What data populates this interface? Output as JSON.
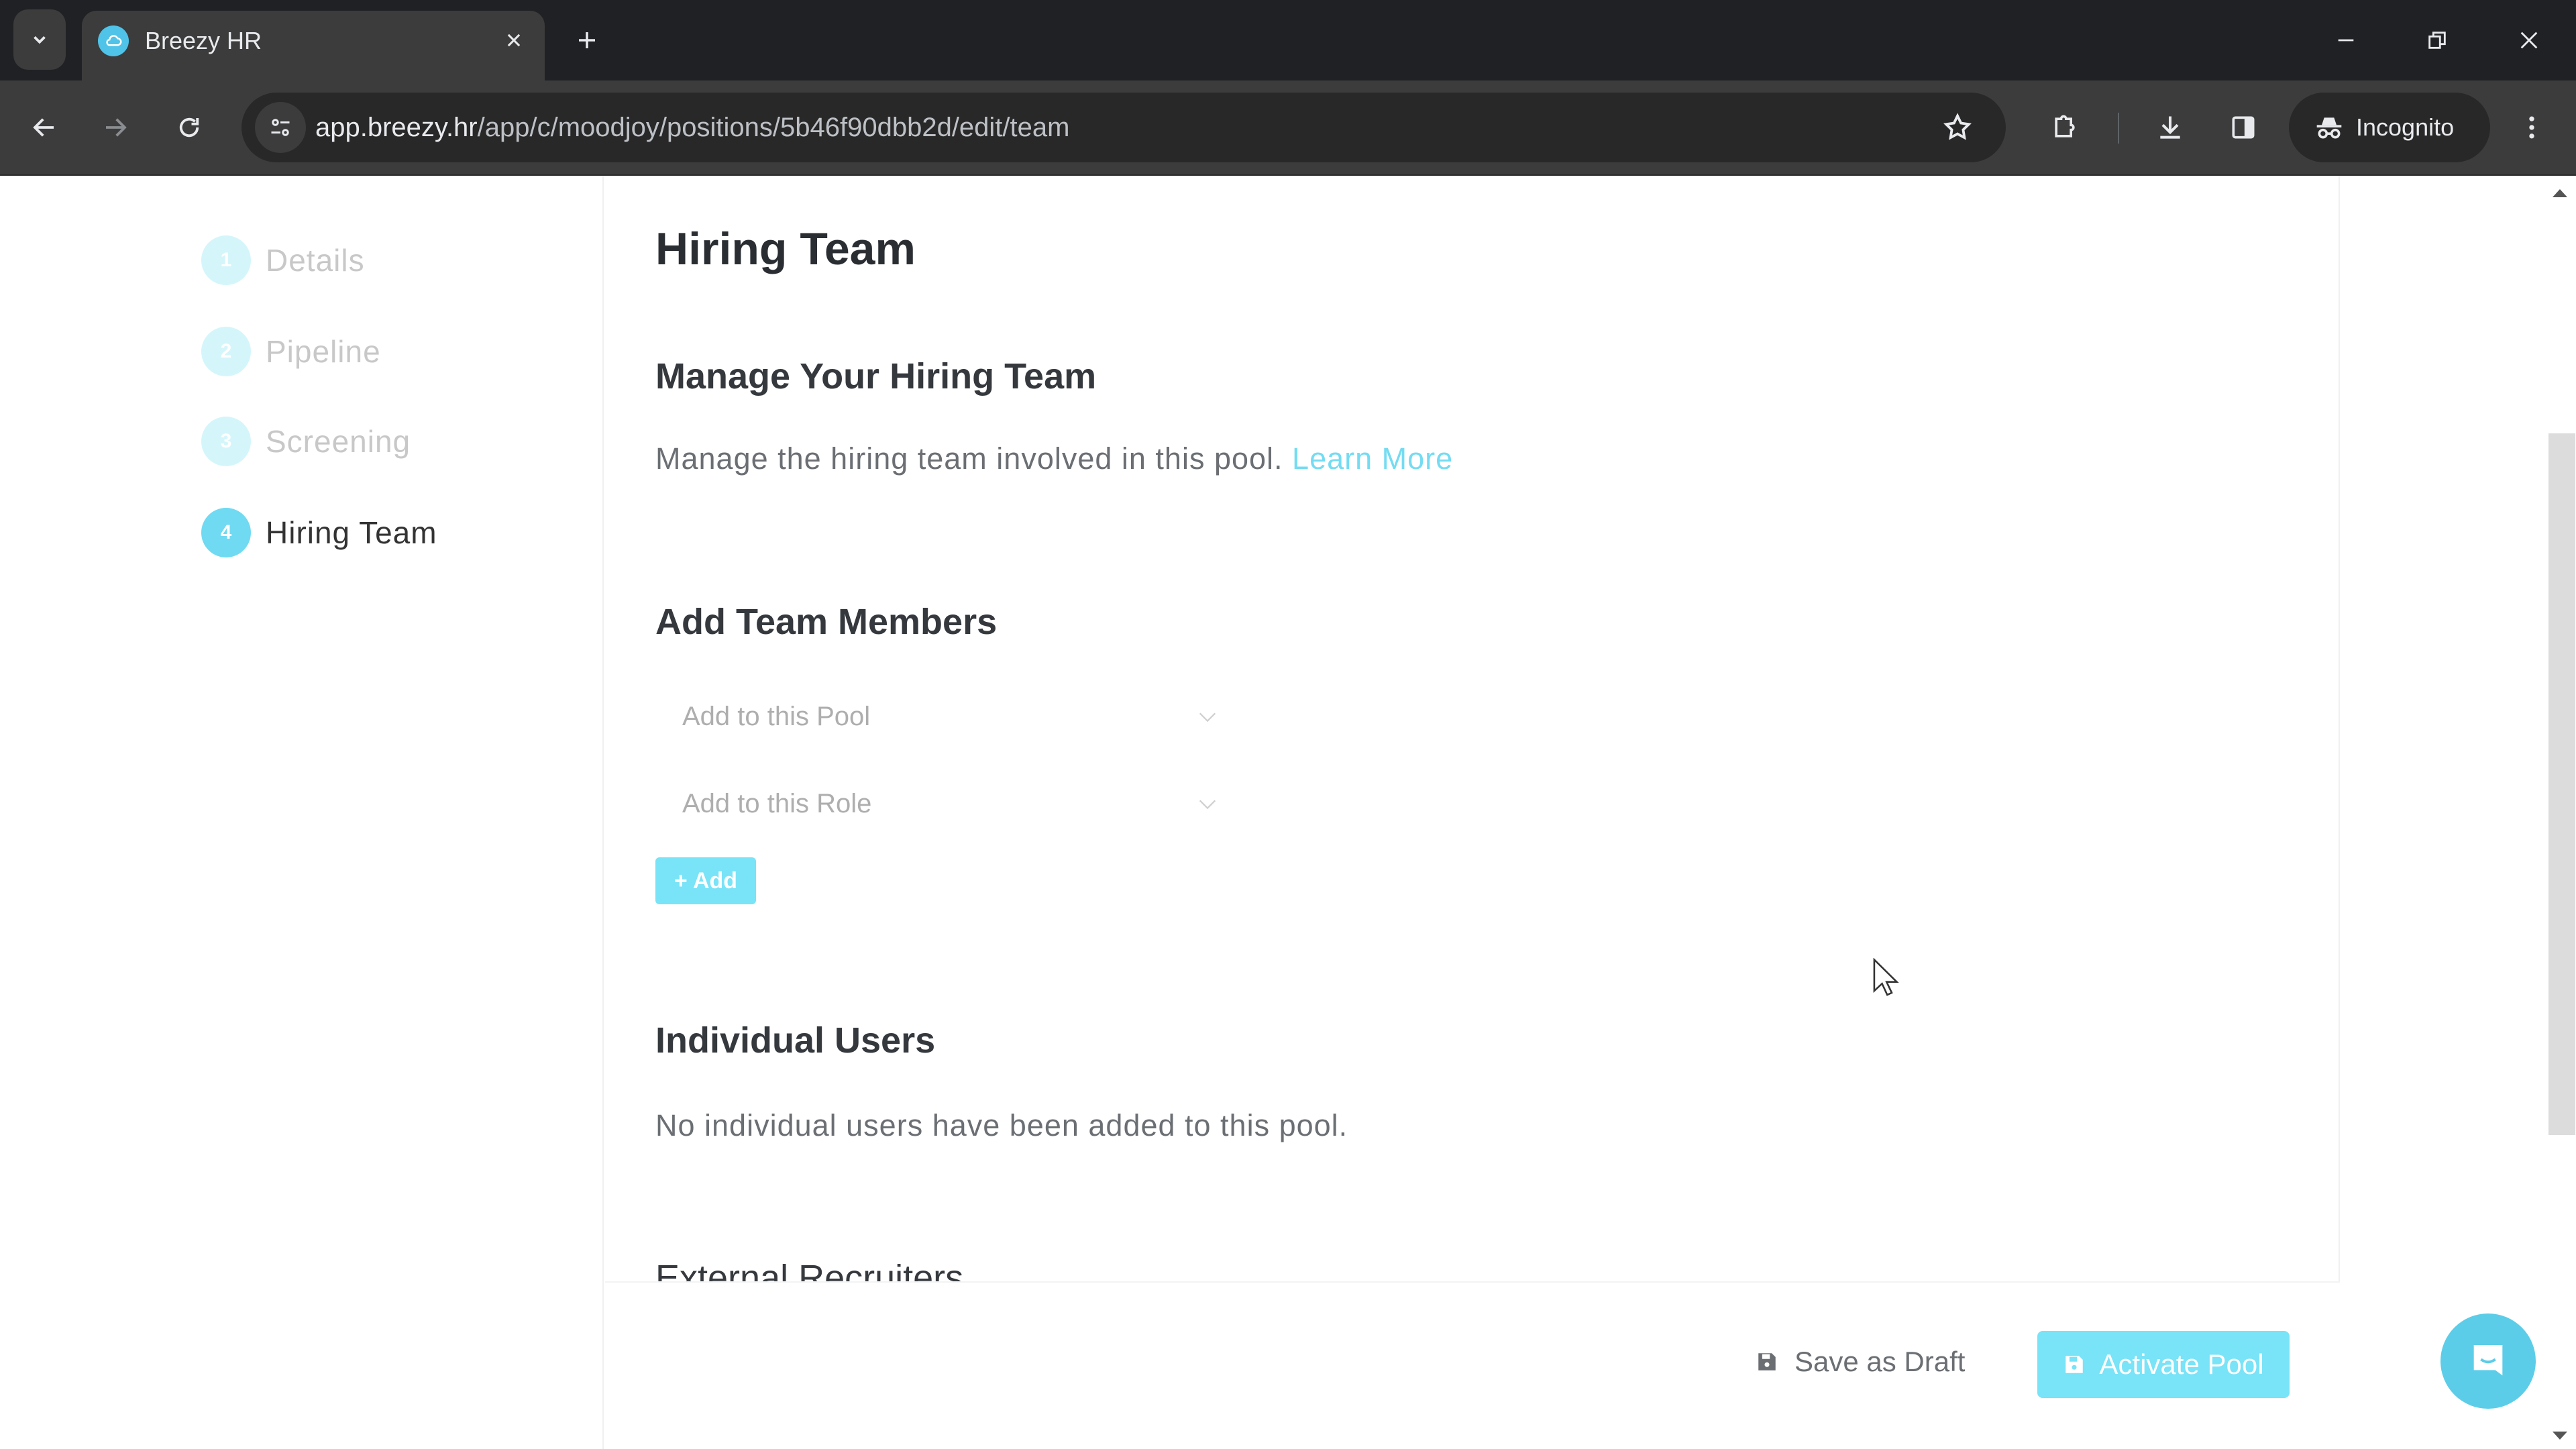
{
  "browser": {
    "tab_title": "Breezy HR",
    "url_host": "app.breezy.hr",
    "url_path": "/app/c/moodjoy/positions/5b46f90dbb2d/edit/team",
    "incognito_label": "Incognito",
    "icons": {
      "tab_search": "chevron-down-icon",
      "favicon": "breezy-cloud-icon",
      "close_tab": "close-icon",
      "new_tab": "plus-icon",
      "minimize": "minimize-icon",
      "restore": "restore-icon",
      "close_window": "close-icon",
      "back": "arrow-left-icon",
      "forward": "arrow-right-icon",
      "reload": "reload-icon",
      "site_info": "tune-icon",
      "bookmark": "star-icon",
      "extensions": "puzzle-icon",
      "downloads": "download-icon",
      "side_panel": "side-panel-icon",
      "incognito": "incognito-icon",
      "menu": "kebab-menu-icon"
    }
  },
  "sidebar": {
    "steps": [
      {
        "number": "1",
        "label": "Details",
        "active": false
      },
      {
        "number": "2",
        "label": "Pipeline",
        "active": false
      },
      {
        "number": "3",
        "label": "Screening",
        "active": false
      },
      {
        "number": "4",
        "label": "Hiring Team",
        "active": true
      }
    ]
  },
  "main": {
    "title": "Hiring Team",
    "manage": {
      "heading": "Manage Your Hiring Team",
      "description": "Manage the hiring team involved in this pool.",
      "link_label": "Learn More"
    },
    "add_members": {
      "heading": "Add Team Members",
      "pool_select_placeholder": "Add to this Pool",
      "role_select_placeholder": "Add to this Role",
      "add_button_label": "+ Add"
    },
    "individual_users": {
      "heading": "Individual Users",
      "empty_text": "No individual users have been added to this pool."
    },
    "external_recruiters": {
      "heading": "External Recruiters"
    }
  },
  "footer": {
    "save_draft_label": "Save as Draft",
    "activate_label": "Activate Pool"
  },
  "colors": {
    "accent": "#79e3f7",
    "link": "#74dcf2",
    "chat": "#5bcde8"
  }
}
